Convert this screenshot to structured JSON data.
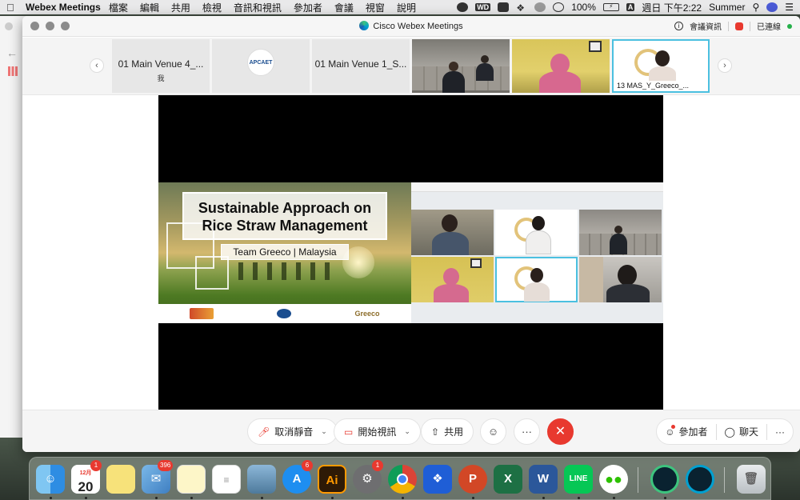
{
  "menubar": {
    "app_name": "Webex Meetings",
    "menus": [
      "檔案",
      "編輯",
      "共用",
      "檢視",
      "音訊和視訊",
      "參加者",
      "會議",
      "視窗",
      "說明"
    ],
    "battery": "100%",
    "input_badge": "A",
    "clock": "週日 下午2:22",
    "user": "Summer"
  },
  "window": {
    "title": "Cisco Webex Meetings",
    "meeting_info": "會議資訊",
    "connection": "已連線"
  },
  "filmstrip": {
    "tiles": [
      {
        "label": "01 Main Venue 4_...",
        "sub": "我"
      },
      {
        "label": "APCAET",
        "sub": ""
      },
      {
        "label": "01 Main Venue 1_S...",
        "sub": ""
      },
      {
        "label": "",
        "sub": ""
      },
      {
        "label": "",
        "sub": ""
      },
      {
        "label": "13 MAS_Y_Greeco_...",
        "sub": ""
      }
    ]
  },
  "slide": {
    "title_line1": "Sustainable Approach on",
    "title_line2": "Rice Straw Management",
    "subtitle": "Team Greeco | Malaysia",
    "footer_logo": "Greeco"
  },
  "controls": {
    "unmute": "取消靜音",
    "start_video": "開始視訊",
    "share": "共用",
    "participants": "參加者",
    "chat": "聊天",
    "more": "···"
  },
  "dock": {
    "calendar_month": "12月",
    "calendar_day": "20",
    "calendar_badge": "1",
    "mail_badge": "396",
    "appstore_badge": "6",
    "prefs_badge": "1",
    "illustrator_label": "Ai",
    "powerpoint_label": "P",
    "excel_label": "X",
    "word_label": "W",
    "line_label": "LINE"
  },
  "colors": {
    "accent": "#4bc0e0",
    "end_call": "#e8392f",
    "connected": "#25b04a"
  }
}
